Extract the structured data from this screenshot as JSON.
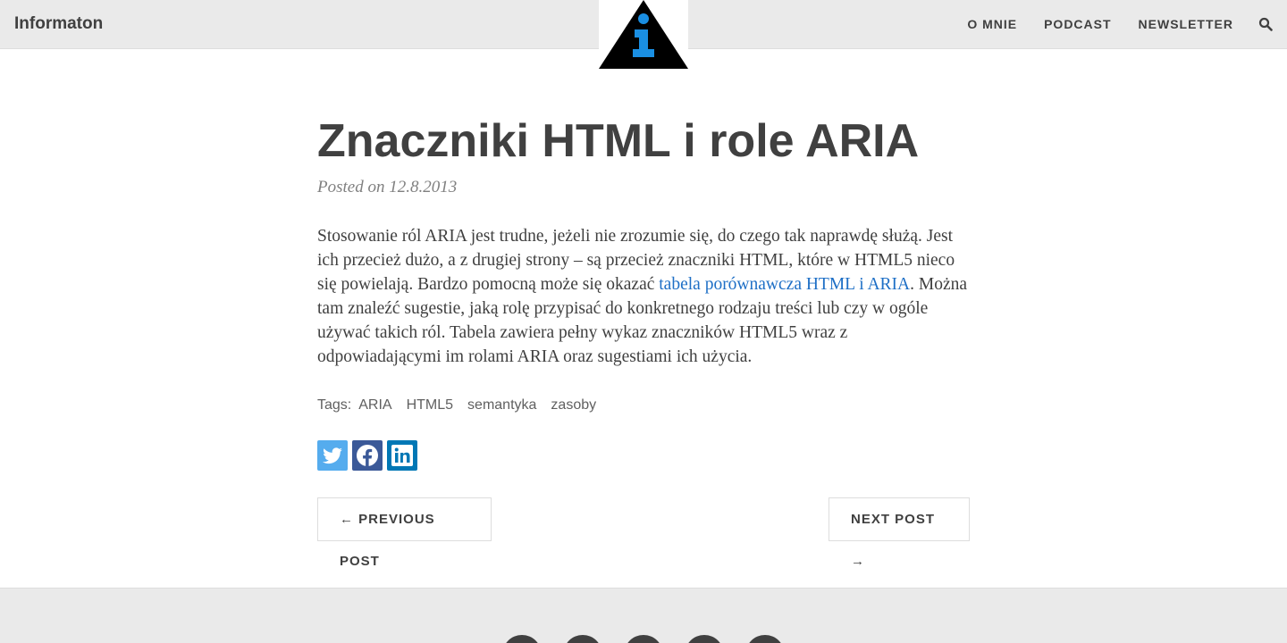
{
  "site": {
    "brand": "Informaton"
  },
  "nav": {
    "items": [
      {
        "label": "O MNIE"
      },
      {
        "label": "PODCAST"
      },
      {
        "label": "NEWSLETTER"
      }
    ],
    "search_icon": "search-icon"
  },
  "post": {
    "title": "Znaczniki HTML i role ARIA",
    "meta": "Posted on 12.8.2013",
    "body_pre": "Stosowanie ról ARIA jest trudne, jeżeli nie zrozumie się, do czego tak naprawdę służą. Jest ich przecież dużo, a z drugiej strony – są przecież znaczniki HTML, które w HTML5 nieco się powielają. Bardzo pomocną może się okazać ",
    "link": "tabela porównawcza HTML i ARIA",
    "body_post": ". Można tam znaleźć sugestie, jaką rolę przypisać do konkretnego rodzaju treści lub czy w ogóle używać takich ról. Tabela zawiera pełny wykaz znaczników HTML5 wraz z odpowiadającymi im rolami ARIA oraz sugestiami ich użycia."
  },
  "tags": {
    "label": "Tags:",
    "items": [
      "ARIA",
      "HTML5",
      "semantyka",
      "zasoby"
    ]
  },
  "share": {
    "icons": [
      "twitter-icon",
      "facebook-icon",
      "linkedin-icon"
    ],
    "colors": {
      "twitter": "#55acee",
      "facebook": "#3b5998",
      "linkedin": "#0077b5"
    }
  },
  "pager": {
    "prev": "← PREVIOUS POST",
    "next": "NEXT POST →"
  },
  "colors": {
    "text": "#404040",
    "link": "#1e6fc6",
    "bar": "#eaeaea",
    "logo_icon": "#1a8fe3"
  },
  "footer": {
    "icon_count": 5
  }
}
